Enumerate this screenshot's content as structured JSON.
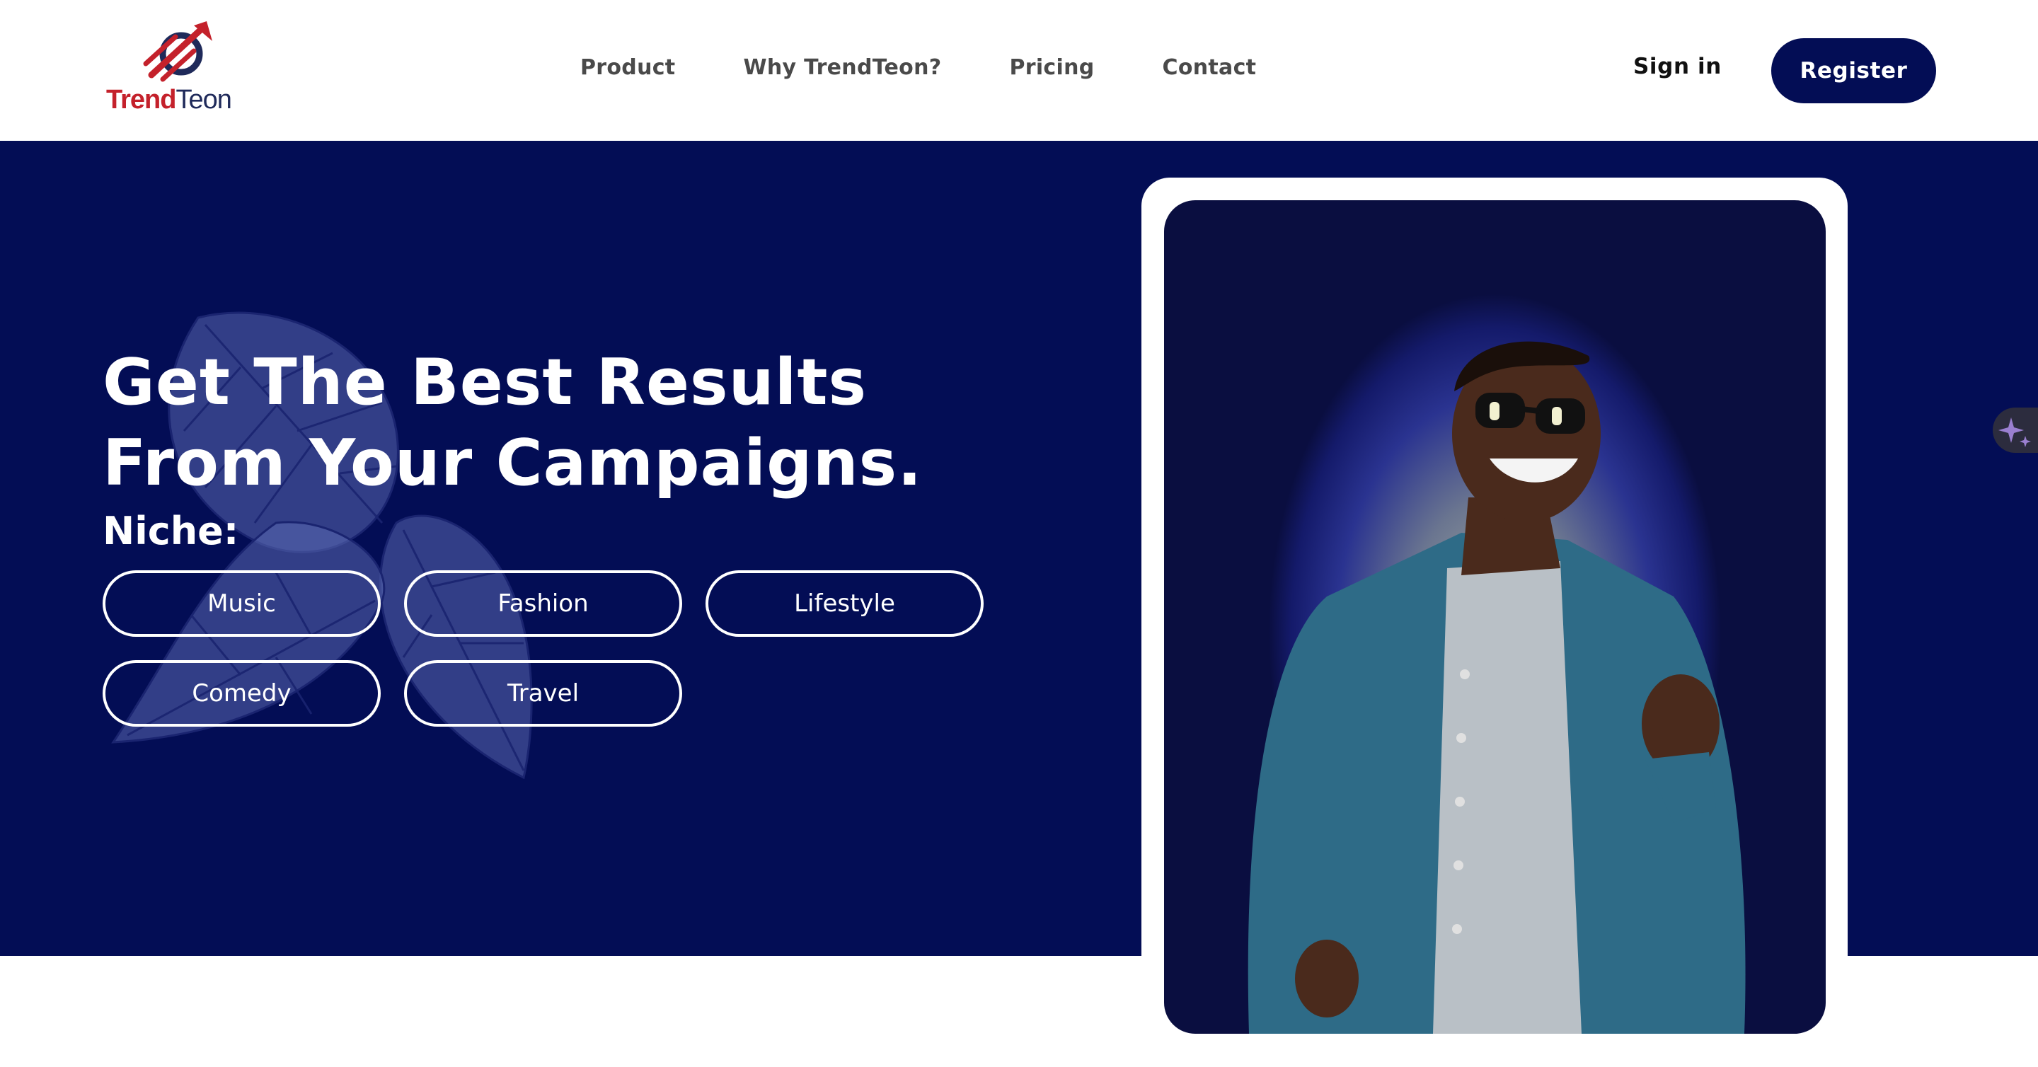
{
  "brand": {
    "name_part1": "Trend",
    "name_part2": "Teon",
    "primary_color": "#c4212b",
    "dark_color": "#030d55"
  },
  "nav": {
    "items": [
      {
        "label": "Product"
      },
      {
        "label": "Why TrendTeon?"
      },
      {
        "label": "Pricing"
      },
      {
        "label": "Contact"
      }
    ]
  },
  "auth": {
    "signin_label": "Sign in",
    "register_label": "Register"
  },
  "hero": {
    "headline_line1": "Get The Best Results",
    "headline_line2": "From Your Campaigns.",
    "niche_label": "Niche:",
    "niches": [
      "Music",
      "Fashion",
      "Lifestyle",
      "Comedy",
      "Travel"
    ],
    "background_color": "#030d55"
  },
  "icons": {
    "side_widget": "sparkle-icon"
  }
}
